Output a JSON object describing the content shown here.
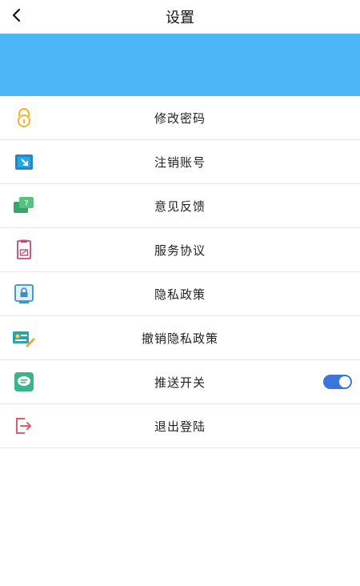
{
  "header": {
    "title": "设置"
  },
  "banner": {
    "color": "#4db6f7"
  },
  "settings": [
    {
      "label": "修改密码",
      "icon": "lock-icon"
    },
    {
      "label": "注销账号",
      "icon": "logout-box-icon"
    },
    {
      "label": "意见反馈",
      "icon": "feedback-chat-icon"
    },
    {
      "label": "服务协议",
      "icon": "document-icon"
    },
    {
      "label": "隐私政策",
      "icon": "privacy-lock-screen-icon"
    },
    {
      "label": "撤销隐私政策",
      "icon": "revoke-document-icon"
    },
    {
      "label": "推送开关",
      "icon": "message-bubble-icon",
      "toggle_on": true
    },
    {
      "label": "退出登陆",
      "icon": "exit-icon"
    }
  ]
}
